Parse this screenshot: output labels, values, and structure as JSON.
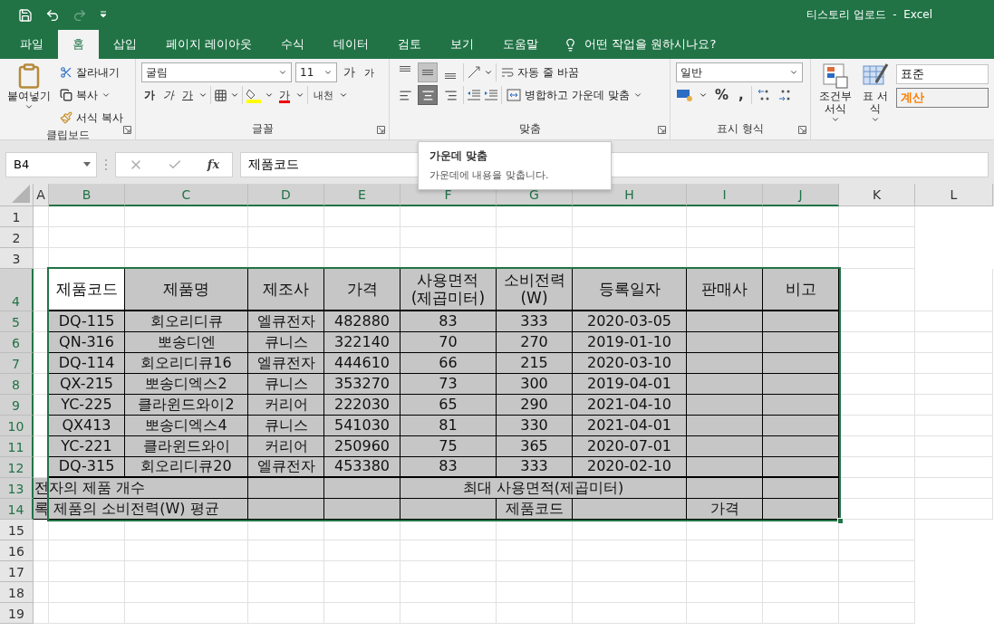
{
  "title_bar": {
    "title": "티스토리 업로드  -  Excel",
    "redo": {
      "disabled": true
    }
  },
  "tabs": [
    {
      "label": "파일",
      "selected": false
    },
    {
      "label": "홈",
      "selected": true
    },
    {
      "label": "삽입",
      "selected": false
    },
    {
      "label": "페이지 레이아웃",
      "selected": false
    },
    {
      "label": "수식",
      "selected": false
    },
    {
      "label": "데이터",
      "selected": false
    },
    {
      "label": "검토",
      "selected": false
    },
    {
      "label": "보기",
      "selected": false
    },
    {
      "label": "도움말",
      "selected": false
    }
  ],
  "tell_me": {
    "placeholder": "어떤 작업을 원하시나요?"
  },
  "clipboard": {
    "label": "클립보드",
    "paste": "붙여넣기",
    "cut": "잘라내기",
    "copy": "복사",
    "format_painter": "서식 복사"
  },
  "font": {
    "label": "글꼴",
    "name": "굴림",
    "size": "11",
    "grow": "가",
    "shrink": "가",
    "bold": "가",
    "italic": "가",
    "underline": "가",
    "font_color": "가",
    "phonetic": "내천"
  },
  "alignment": {
    "label": "맞춤",
    "wrap_text": "자동 줄 바꿈",
    "merge_center": "병합하고 가운데 맞춤",
    "vertical": [
      {
        "kind": "top",
        "selected": false,
        "hovered": false
      },
      {
        "kind": "middle",
        "selected": true,
        "hovered": false
      },
      {
        "kind": "bottom",
        "selected": false,
        "hovered": false
      }
    ],
    "horizontal": [
      {
        "kind": "left",
        "selected": false,
        "hovered": false
      },
      {
        "kind": "center",
        "selected": true,
        "hovered": true
      },
      {
        "kind": "right",
        "selected": false,
        "hovered": false
      }
    ]
  },
  "number": {
    "label": "표시 형식",
    "format": "일반",
    "percent": "%",
    "comma": ","
  },
  "styles": {
    "conditional": "조건부 서식",
    "table": "표 서식",
    "cell_styles": [
      {
        "label": "표준",
        "kind": "normal"
      },
      {
        "label": "계산",
        "kind": "calculation"
      }
    ]
  },
  "tooltip": {
    "title": "가운데 맞춤",
    "text": "가운데에 내용을 맞춥니다."
  },
  "formula_bar": {
    "name_box": "B4",
    "function": "fx",
    "value": "제품코드"
  },
  "sheet": {
    "columns": [
      {
        "label": "A",
        "selected": false
      },
      {
        "label": "B",
        "selected": true
      },
      {
        "label": "C",
        "selected": true
      },
      {
        "label": "D",
        "selected": true
      },
      {
        "label": "E",
        "selected": true
      },
      {
        "label": "F",
        "selected": true
      },
      {
        "label": "G",
        "selected": true
      },
      {
        "label": "H",
        "selected": true
      },
      {
        "label": "I",
        "selected": true
      },
      {
        "label": "J",
        "selected": true
      },
      {
        "label": "K",
        "selected": false
      },
      {
        "label": "L",
        "selected": false
      }
    ],
    "rows": [
      {
        "label": "1",
        "selected": false
      },
      {
        "label": "2",
        "selected": false
      },
      {
        "label": "3",
        "selected": false
      },
      {
        "label": "4",
        "selected": true
      },
      {
        "label": "5",
        "selected": true
      },
      {
        "label": "6",
        "selected": true
      },
      {
        "label": "7",
        "selected": true
      },
      {
        "label": "8",
        "selected": true
      },
      {
        "label": "9",
        "selected": true
      },
      {
        "label": "10",
        "selected": true
      },
      {
        "label": "11",
        "selected": true
      },
      {
        "label": "12",
        "selected": true
      },
      {
        "label": "13",
        "selected": true
      },
      {
        "label": "14",
        "selected": true
      },
      {
        "label": "15",
        "selected": false
      },
      {
        "label": "16",
        "selected": false
      },
      {
        "label": "17",
        "selected": false
      },
      {
        "label": "18",
        "selected": false
      },
      {
        "label": "19",
        "selected": false
      }
    ]
  },
  "table": {
    "header": [
      {
        "text": "제품코드",
        "active": true
      },
      {
        "text": "제품명",
        "active": false
      },
      {
        "text": "제조사",
        "active": false
      },
      {
        "text": "가격",
        "active": false
      },
      {
        "text": "사용면적\n(제곱미터)",
        "active": false
      },
      {
        "text": "소비전력\n(W)",
        "active": false
      },
      {
        "text": "등록일자",
        "active": false
      },
      {
        "text": "판매사",
        "active": false
      },
      {
        "text": "비고",
        "active": false
      }
    ],
    "rows": [
      [
        "DQ-115",
        "회오리디큐",
        "엘큐전자",
        "482880",
        "83",
        "333",
        "2020-03-05"
      ],
      [
        "QN-316",
        "뽀송디엔",
        "큐니스",
        "322140",
        "70",
        "270",
        "2019-01-10"
      ],
      [
        "DQ-114",
        "회오리디큐16",
        "엘큐전자",
        "444610",
        "66",
        "215",
        "2020-03-10"
      ],
      [
        "QX-215",
        "뽀송디엑스2",
        "큐니스",
        "353270",
        "73",
        "300",
        "2019-04-01"
      ],
      [
        "YC-225",
        "클라윈드와이2",
        "커리어",
        "222030",
        "65",
        "290",
        "2021-04-10"
      ],
      [
        "QX413",
        "뽀송디엑스4",
        "큐니스",
        "541030",
        "81",
        "330",
        "2021-04-01"
      ],
      [
        "YC-221",
        "클라윈드와이",
        "커리어",
        "250960",
        "75",
        "365",
        "2020-07-01"
      ],
      [
        "DQ-315",
        "회오리디큐20",
        "엘큐전자",
        "453380",
        "83",
        "333",
        "2020-02-10"
      ]
    ],
    "summary": [
      {
        "label": "전자의 제품 개수",
        "middle": "최대 사용면적(제곱미터)"
      },
      {
        "label": "록 제품의 소비전력(W) 평균",
        "code_label": "제품코드",
        "price_label": "가격"
      }
    ]
  }
}
